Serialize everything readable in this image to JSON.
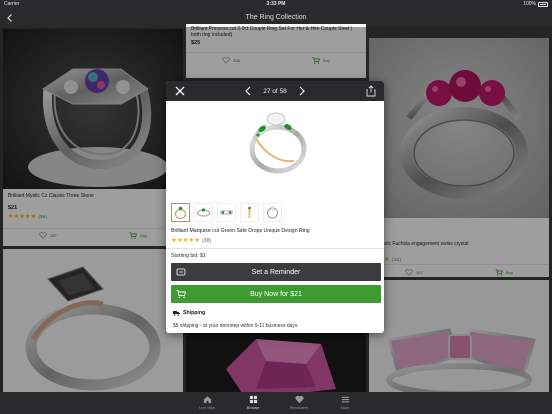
{
  "status": {
    "carrier": "Carrier",
    "time": "3:33 PM",
    "battery": "100%"
  },
  "nav": {
    "title": "The Ring Collection"
  },
  "cards": [
    {
      "name": "Brilliant Mystic Cz Classic Three Stone",
      "price": "$21",
      "stars": "★★★★★",
      "rating_count": "(56)",
      "likes": "387",
      "buy": "Buy"
    },
    {
      "name": "Brilliant Princess cut 2.0ct Couple Ring Set For Her & Him Couple Steel  ( both ring included)",
      "price": "$25",
      "likes": "336",
      "buy": "Buy"
    },
    {
      "name": "y Classic Fuchsia engagement swiss crystal",
      "stars": "★★★",
      "rating_count": "(33)",
      "likes": "387",
      "buy": "Buy"
    }
  ],
  "modal": {
    "pager": "27 of 58",
    "product_title": "Brilliant Marquise cut Green Side Drops Unique Design Ring",
    "stars": "★★★★★",
    "rating_count": "(38)",
    "starting_bid": "Starting bid: $1",
    "reminder_label": "Set a Reminder",
    "buy_label": "Buy Now for $21",
    "shipping_title": "Shipping",
    "shipping_text": "$5 shipping - at your doorstep within 9-11 business days."
  },
  "tabs": [
    {
      "label": "Live Now"
    },
    {
      "label": "Browse"
    },
    {
      "label": "Reminders"
    },
    {
      "label": "More"
    }
  ],
  "colors": {
    "accent_green": "#3e9b32",
    "bar_dark": "#2a2a2d",
    "star": "#f0b400",
    "gem_green": "#1d8f2c",
    "gem_pink": "#c2186f"
  }
}
